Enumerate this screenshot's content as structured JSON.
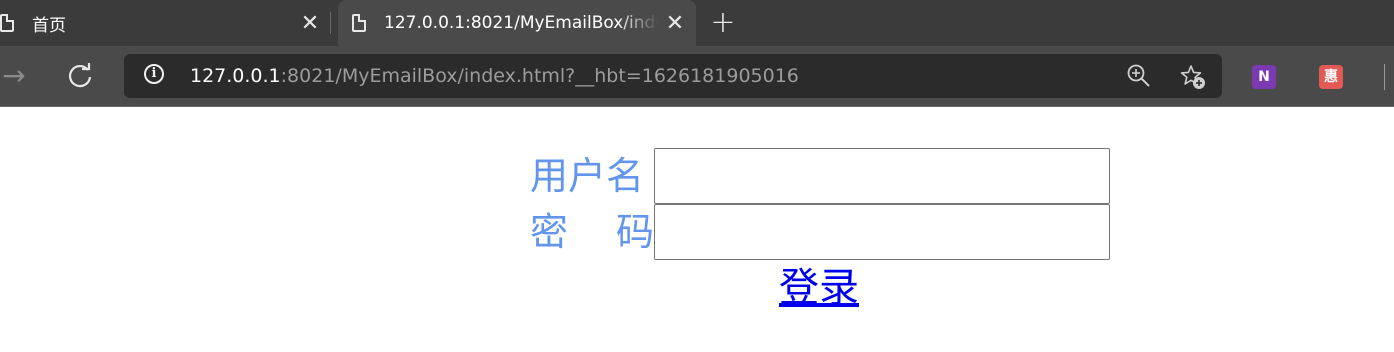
{
  "browser": {
    "tabs": [
      {
        "title": "首页",
        "close": "✕",
        "active": false
      },
      {
        "title": "127.0.0.1:8021/MyEmailBox/index.html",
        "close": "✕",
        "active": true
      }
    ],
    "new_tab": "+",
    "back": "←",
    "forward": "→",
    "reload": "↻",
    "info": "i",
    "url_host": "127.0.0.1",
    "url_rest": ":8021/MyEmailBox/index.html?__hbt=1626181905016",
    "extensions": {
      "onenote": "N",
      "hui": "惠"
    },
    "colors": {
      "chrome_dark": "#3b3b3b",
      "chrome": "#4a4a4a",
      "address_bg": "#2b2b2b"
    },
    "icons": [
      "doc-icon",
      "close-icon",
      "plus-icon",
      "forward-icon",
      "reload-icon",
      "info-icon",
      "zoom-icon",
      "favorite-add-icon",
      "onenote-icon",
      "hui-icon"
    ]
  },
  "login": {
    "username_label": "用户名",
    "password_label_1": "密",
    "password_label_2": "码",
    "username_value": "",
    "password_value": "",
    "submit_label": "登录",
    "colors": {
      "label": "#6495ed",
      "link": "#0000ee"
    }
  }
}
